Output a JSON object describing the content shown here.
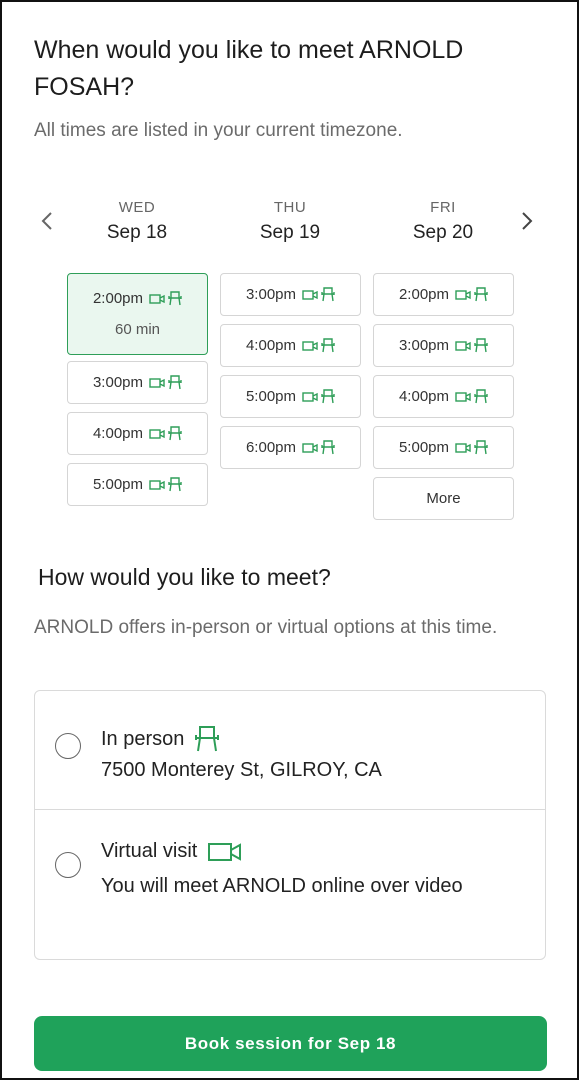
{
  "header": {
    "title": "When would you like to meet ARNOLD FOSAH?",
    "subtitle": "All times are listed in your current timezone."
  },
  "calendar": {
    "prev_icon": "chevron-left-icon",
    "next_icon": "chevron-right-icon",
    "days": [
      {
        "dow": "WED",
        "date": "Sep 18",
        "slots": [
          "2:00pm",
          "3:00pm",
          "4:00pm",
          "5:00pm"
        ],
        "selected_duration": "60 min"
      },
      {
        "dow": "THU",
        "date": "Sep 19",
        "slots": [
          "3:00pm",
          "4:00pm",
          "5:00pm",
          "6:00pm"
        ]
      },
      {
        "dow": "FRI",
        "date": "Sep 20",
        "slots": [
          "2:00pm",
          "3:00pm",
          "4:00pm",
          "5:00pm"
        ],
        "more_label": "More"
      }
    ],
    "slot_icons": [
      "video-icon",
      "chair-icon"
    ],
    "accent_color": "#2e9e58"
  },
  "meeting": {
    "heading": "How would you like to meet?",
    "description": "ARNOLD offers in-person or virtual options at this time.",
    "options": [
      {
        "label": "In person",
        "icon": "chair-icon",
        "detail": "7500 Monterey St, GILROY, CA"
      },
      {
        "label": "Virtual visit",
        "icon": "video-icon",
        "detail": "You will meet ARNOLD online over video"
      }
    ]
  },
  "footer": {
    "book_label": "Book session for Sep 18",
    "button_color": "#1fa25a"
  }
}
